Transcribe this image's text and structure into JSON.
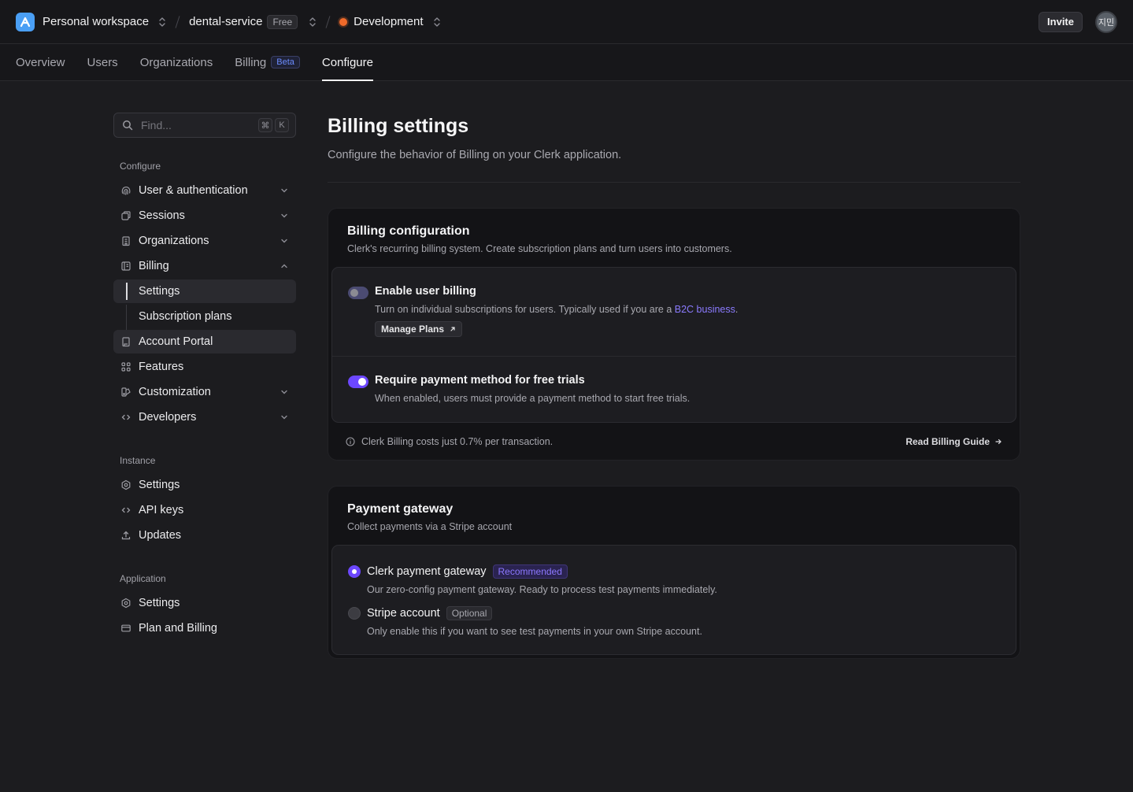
{
  "topbar": {
    "workspace": "Personal workspace",
    "app_name": "dental-service",
    "plan_badge": "Free",
    "environment": "Development",
    "invite_label": "Invite",
    "avatar_initials": "지민"
  },
  "tabs": [
    {
      "label": "Overview"
    },
    {
      "label": "Users"
    },
    {
      "label": "Organizations"
    },
    {
      "label": "Billing",
      "badge": "Beta"
    },
    {
      "label": "Configure",
      "active": true
    }
  ],
  "sidebar": {
    "search_placeholder": "Find...",
    "search_shortcut": [
      "⌘",
      "K"
    ],
    "configure_title": "Configure",
    "configure_items": [
      {
        "label": "User & authentication",
        "icon": "fingerprint-icon"
      },
      {
        "label": "Sessions",
        "icon": "sessions-icon"
      },
      {
        "label": "Organizations",
        "icon": "building-icon"
      },
      {
        "label": "Billing",
        "icon": "billing-icon",
        "expanded": true
      },
      {
        "label": "Settings",
        "sub": true,
        "active": true
      },
      {
        "label": "Subscription plans",
        "sub": true
      },
      {
        "label": "Account Portal",
        "icon": "portal-icon"
      },
      {
        "label": "Features",
        "icon": "grid-icon"
      },
      {
        "label": "Customization",
        "icon": "palette-icon"
      },
      {
        "label": "Developers",
        "icon": "code-icon"
      }
    ],
    "instance_title": "Instance",
    "instance_items": [
      {
        "label": "Settings",
        "icon": "hex-gear-icon"
      },
      {
        "label": "API keys",
        "icon": "code-icon"
      },
      {
        "label": "Updates",
        "icon": "upload-icon"
      }
    ],
    "application_title": "Application",
    "application_items": [
      {
        "label": "Settings",
        "icon": "hex-gear-icon"
      },
      {
        "label": "Plan and Billing",
        "icon": "card-icon"
      }
    ]
  },
  "main": {
    "title": "Billing settings",
    "subtitle": "Configure the behavior of Billing on your Clerk application.",
    "billing_config": {
      "title": "Billing configuration",
      "subtitle": "Clerk's recurring billing system. Create subscription plans and turn users into customers.",
      "enable_user_billing": {
        "title": "Enable user billing",
        "desc_prefix": "Turn on individual subscriptions for users. Typically used if you are a ",
        "desc_link": "B2C business",
        "desc_suffix": ".",
        "button": "Manage Plans",
        "enabled": false
      },
      "require_payment": {
        "title": "Require payment method for free trials",
        "desc": "When enabled, users must provide a payment method to start free trials.",
        "enabled": true
      },
      "footer_note": "Clerk Billing costs just 0.7% per transaction.",
      "footer_link": "Read Billing Guide"
    },
    "payment_gateway": {
      "title": "Payment gateway",
      "subtitle": "Collect payments via a Stripe account",
      "options": [
        {
          "title": "Clerk payment gateway",
          "tag": "Recommended",
          "desc": "Our zero-config payment gateway. Ready to process test payments immediately.",
          "selected": true
        },
        {
          "title": "Stripe account",
          "tag": "Optional",
          "desc": "Only enable this if you want to see test payments in your own Stripe account.",
          "selected": false
        }
      ]
    }
  },
  "colors": {
    "accent": "#6c47ff",
    "link": "#8b7bff",
    "env_dot": "#f06a2a",
    "logo": "#4a9ff5"
  }
}
